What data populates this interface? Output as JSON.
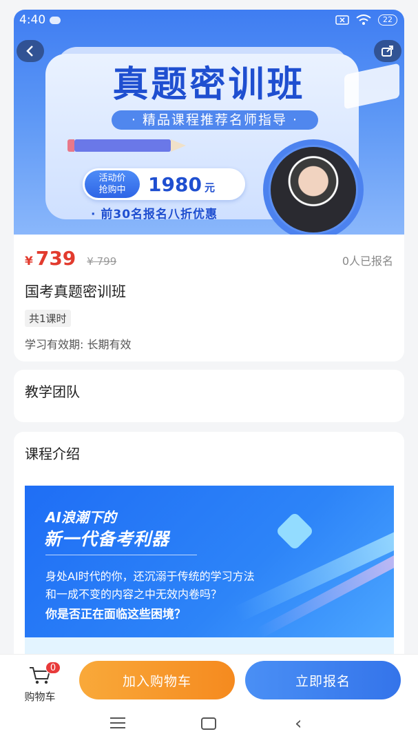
{
  "status_bar": {
    "time": "4:40",
    "battery": "22"
  },
  "banner": {
    "title": "真题密训班",
    "subtitle": "· 精品课程推荐名师指导 ·",
    "price_tag": "活动价\n抢购中",
    "price_tag_line1": "活动价",
    "price_tag_line2": "抢购中",
    "price": "1980",
    "price_unit": "元",
    "promo": "· 前30名报名八折优惠"
  },
  "course": {
    "currency": "¥",
    "price": "739",
    "old_price": "¥ 799",
    "enrolled": "0人已报名",
    "title": "国考真题密训班",
    "lessons_badge": "共1课时",
    "validity": "学习有效期: 长期有效"
  },
  "sections": {
    "team_title": "教学团队",
    "intro_title": "课程介绍"
  },
  "intro_image": {
    "line1": "AI浪潮下的",
    "line2": "新一代备考利器",
    "line3": "身处AI时代的你，还沉溺于传统的学习方法",
    "line4": "和一成不变的内容之中无效内卷吗？",
    "line5": "你是否正在面临这些困境？"
  },
  "bottom_bar": {
    "cart_label": "购物车",
    "cart_count": "0",
    "add_to_cart": "加入购物车",
    "enroll_now": "立即报名"
  },
  "colors": {
    "accent_blue": "#3474ea",
    "accent_orange": "#f58a1f",
    "price_red": "#e23b2e"
  },
  "icons": [
    "back-icon",
    "share-icon",
    "cart-icon",
    "menu-icon",
    "home-icon",
    "nav-back-icon"
  ]
}
